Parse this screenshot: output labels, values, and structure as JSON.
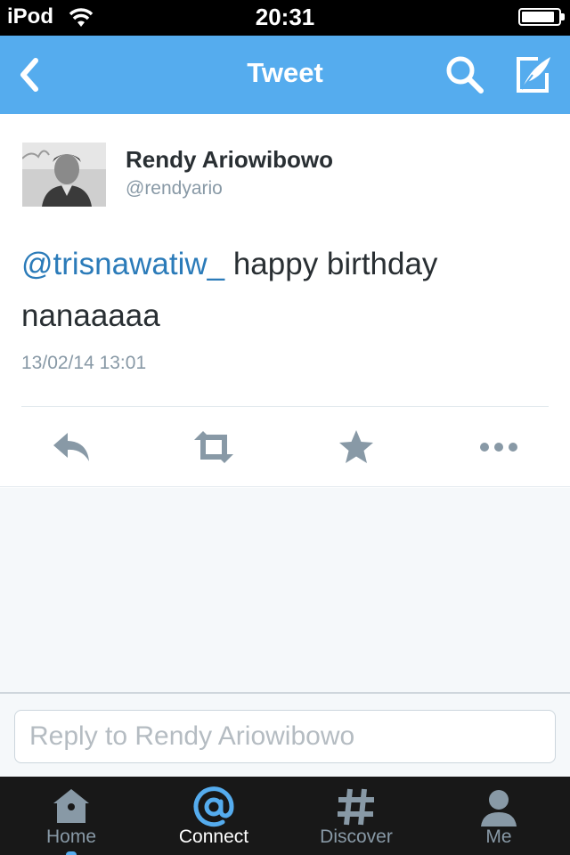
{
  "status_bar": {
    "carrier": "iPod",
    "time": "20:31",
    "battery_level": 0.9
  },
  "nav": {
    "title": "Tweet",
    "back_icon": "chevron-left-icon",
    "search_icon": "search-icon",
    "compose_icon": "compose-icon"
  },
  "tweet": {
    "author_name": "Rendy Ariowibowo",
    "author_handle": "@rendyario",
    "mention": "@trisnawatiw_",
    "text": " happy birthday nanaaaaa",
    "timestamp": "13/02/14 13:01",
    "actions": [
      "reply-icon",
      "retweet-icon",
      "favorite-icon",
      "more-icon"
    ]
  },
  "reply": {
    "placeholder": "Reply to Rendy Ariowibowo",
    "value": ""
  },
  "tabs": [
    {
      "label": "Home",
      "icon": "home-icon",
      "active": false
    },
    {
      "label": "Connect",
      "icon": "at-icon",
      "active": true
    },
    {
      "label": "Discover",
      "icon": "hashtag-icon",
      "active": false
    },
    {
      "label": "Me",
      "icon": "person-icon",
      "active": false
    }
  ],
  "colors": {
    "brand": "#55acee",
    "link": "#2b7bb9",
    "muted": "#8899a6",
    "tab_bar": "#181818"
  }
}
